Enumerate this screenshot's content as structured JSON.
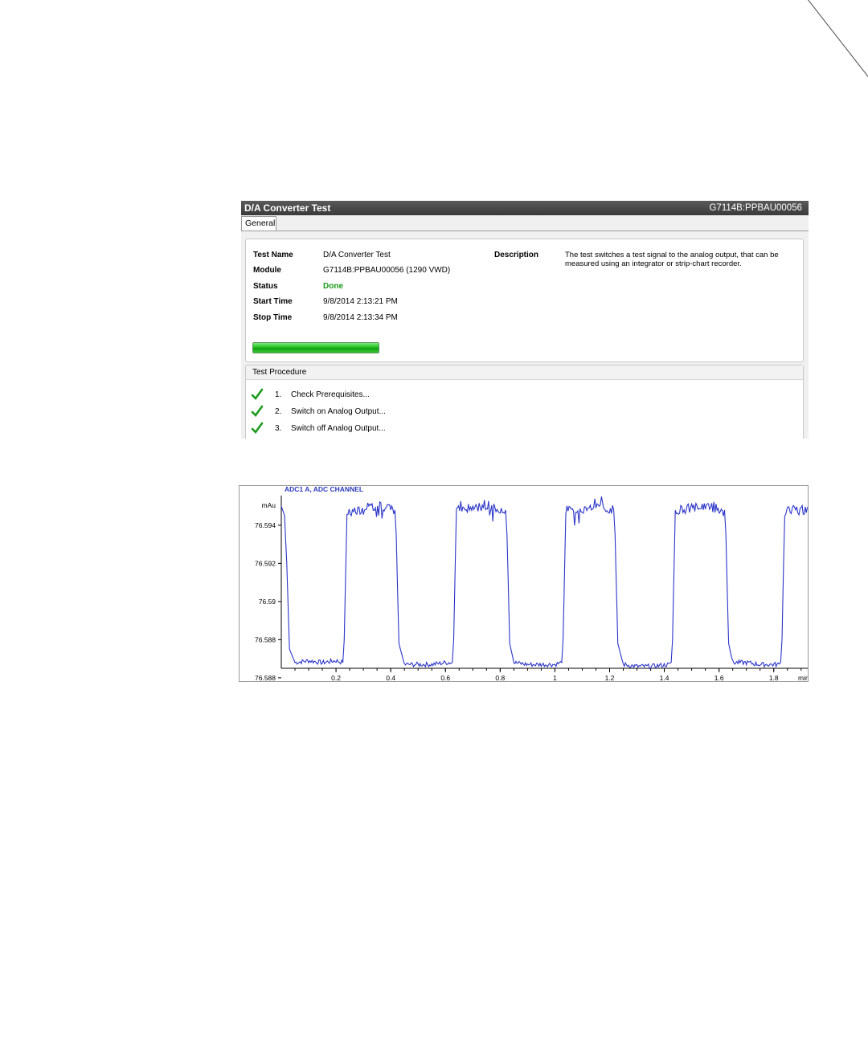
{
  "window": {
    "title": "D/A Converter Test",
    "module_id": "G7114B:PPBAU00056",
    "tabs": [
      {
        "label": "General"
      }
    ]
  },
  "info": {
    "test_name_label": "Test Name",
    "test_name": "D/A Converter Test",
    "module_label": "Module",
    "module": "G7114B:PPBAU00056 (1290 VWD)",
    "status_label": "Status",
    "status": "Done",
    "status_color": "#1a9a1a",
    "start_label": "Start Time",
    "start_time": "9/8/2014 2:13:21 PM",
    "stop_label": "Stop Time",
    "stop_time": "9/8/2014 2:13:34 PM",
    "description_label": "Description",
    "description": "The test switches a test signal to the analog output, that can be measured using an integrator or strip-chart recorder.",
    "progress": 1.0
  },
  "procedure": {
    "header": "Test Procedure",
    "steps": [
      {
        "num": "1.",
        "label": "Check Prerequisites...",
        "done": true,
        "icon": "check-icon"
      },
      {
        "num": "2.",
        "label": "Switch on Analog Output...",
        "done": true,
        "icon": "check-icon"
      },
      {
        "num": "3.",
        "label": "Switch off Analog Output...",
        "done": true,
        "icon": "check-icon"
      }
    ]
  },
  "chart_data": {
    "type": "line",
    "title": "ADC1 A, ADC CHANNEL",
    "ylabel": "mAu",
    "xlabel": "min",
    "color": "#2b35c8",
    "ylim": [
      76.5865,
      76.5953
    ],
    "xlim": [
      0,
      1.93
    ],
    "yticks": [
      "76.594",
      "76.592",
      "76.59",
      "76.588",
      "76.588"
    ],
    "ytick_values": [
      76.594,
      76.592,
      76.59,
      76.588,
      76.586
    ],
    "xticks": [
      "0.2",
      "0.4",
      "0.6",
      "0.8",
      "1",
      "1.2",
      "1.4",
      "1.6",
      "1.8",
      "min"
    ],
    "xtick_values": [
      0.2,
      0.4,
      0.6,
      0.8,
      1.0,
      1.2,
      1.4,
      1.6,
      1.8
    ],
    "series": [
      {
        "points": [
          [
            0.0,
            76.595
          ],
          [
            0.012,
            76.5945
          ],
          [
            0.02,
            76.592
          ],
          [
            0.03,
            76.5875
          ],
          [
            0.05,
            76.5868
          ],
          [
            0.1,
            76.5869
          ],
          [
            0.15,
            76.5868
          ],
          [
            0.2,
            76.5869
          ],
          [
            0.225,
            76.5868
          ],
          [
            0.23,
            76.588
          ],
          [
            0.24,
            76.5947
          ],
          [
            0.3,
            76.5948
          ],
          [
            0.34,
            76.595
          ],
          [
            0.36,
            76.5951
          ],
          [
            0.4,
            76.5948
          ],
          [
            0.415,
            76.5948
          ],
          [
            0.42,
            76.5935
          ],
          [
            0.43,
            76.5878
          ],
          [
            0.45,
            76.5867
          ],
          [
            0.5,
            76.5867
          ],
          [
            0.55,
            76.5867
          ],
          [
            0.6,
            76.5868
          ],
          [
            0.625,
            76.5868
          ],
          [
            0.63,
            76.588
          ],
          [
            0.64,
            76.5948
          ],
          [
            0.7,
            76.5949
          ],
          [
            0.75,
            76.595
          ],
          [
            0.8,
            76.5949
          ],
          [
            0.82,
            76.5948
          ],
          [
            0.825,
            76.5935
          ],
          [
            0.835,
            76.5878
          ],
          [
            0.85,
            76.5868
          ],
          [
            0.9,
            76.5867
          ],
          [
            0.95,
            76.5867
          ],
          [
            1.0,
            76.5867
          ],
          [
            1.025,
            76.5868
          ],
          [
            1.03,
            76.588
          ],
          [
            1.04,
            76.5948
          ],
          [
            1.1,
            76.5948
          ],
          [
            1.15,
            76.595
          ],
          [
            1.215,
            76.5948
          ],
          [
            1.22,
            76.5935
          ],
          [
            1.23,
            76.5878
          ],
          [
            1.25,
            76.5867
          ],
          [
            1.3,
            76.5866
          ],
          [
            1.35,
            76.5866
          ],
          [
            1.42,
            76.5867
          ],
          [
            1.425,
            76.5868
          ],
          [
            1.43,
            76.588
          ],
          [
            1.44,
            76.5948
          ],
          [
            1.5,
            76.5949
          ],
          [
            1.55,
            76.595
          ],
          [
            1.62,
            76.5948
          ],
          [
            1.625,
            76.5935
          ],
          [
            1.635,
            76.5878
          ],
          [
            1.65,
            76.5868
          ],
          [
            1.7,
            76.5868
          ],
          [
            1.75,
            76.5867
          ],
          [
            1.82,
            76.5867
          ],
          [
            1.825,
            76.5868
          ],
          [
            1.83,
            76.588
          ],
          [
            1.84,
            76.5947
          ],
          [
            1.9,
            76.5948
          ],
          [
            1.93,
            76.5948
          ]
        ]
      }
    ]
  }
}
